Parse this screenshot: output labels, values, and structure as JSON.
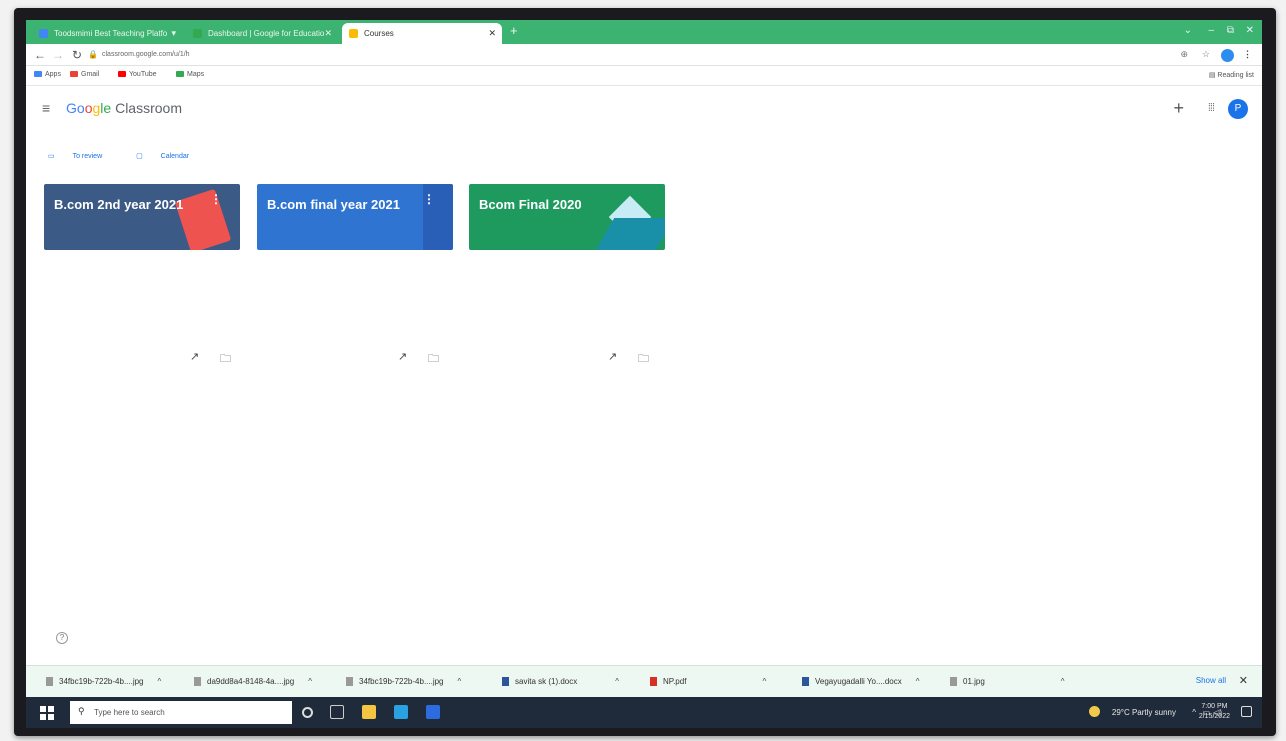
{
  "browser": {
    "tabs": [
      {
        "title": "Toodsmimi Best Teaching Platfo",
        "favicon_color": "#4285f4"
      },
      {
        "title": "Dashboard | Google for Educatio",
        "favicon_color": "#34a853"
      },
      {
        "title": "Courses",
        "favicon_color": "#fbbc05"
      }
    ],
    "address_url": "classroom.google.com/u/1/h",
    "bookmarks": [
      {
        "label": "Apps",
        "color": "#4285f4"
      },
      {
        "label": "Gmail",
        "color": "#ea4335"
      },
      {
        "label": "YouTube",
        "color": "#ff0000"
      },
      {
        "label": "Maps",
        "color": "#34a853"
      }
    ],
    "reading_list_label": "Reading list"
  },
  "classroom": {
    "logo_google": [
      "Go",
      "o",
      "g",
      "le"
    ],
    "logo_product": "Classroom",
    "avatar_letter": "P",
    "quick_links": {
      "to_review": "To review",
      "calendar": "Calendar"
    },
    "courses": [
      {
        "title": "B.com 2nd year 2021",
        "color": "#3b5a86"
      },
      {
        "title": "B.com final year 2021",
        "color": "#2f74d0"
      },
      {
        "title": "Bcom Final 2020",
        "color": "#1f9a5f"
      }
    ]
  },
  "downloads": {
    "items": [
      {
        "name": "34fbc19b-722b-4b....jpg"
      },
      {
        "name": "da9dd8a4-8148-4a....jpg"
      },
      {
        "name": "34fbc19b-722b-4b....jpg"
      },
      {
        "name": "savita sk (1).docx"
      },
      {
        "name": "NP.pdf"
      },
      {
        "name": "Vegayugadalli Yo....docx"
      },
      {
        "name": "01.jpg"
      }
    ],
    "show_all": "Show all"
  },
  "taskbar": {
    "search_placeholder": "Type here to search",
    "weather": "29°C  Partly sunny",
    "time": "7:00 PM",
    "date": "2/15/2022"
  }
}
